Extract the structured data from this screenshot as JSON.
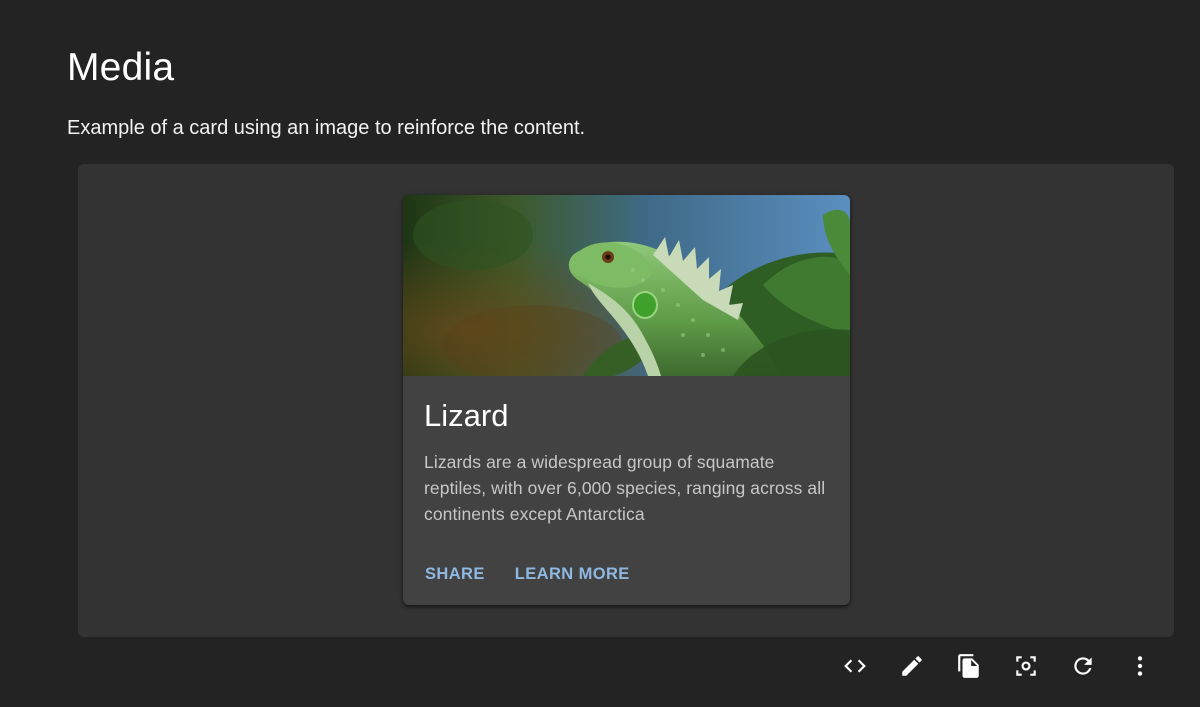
{
  "section": {
    "title": "Media",
    "description": "Example of a card using an image to reinforce the content."
  },
  "card": {
    "heading": "Lizard",
    "body": "Lizards are a widespread group of squamate reptiles, with over 6,000 species, ranging across all continents except Antarctica",
    "media_icon": "green-iguana-image",
    "actions": {
      "share_label": "SHARE",
      "learn_more_label": "LEARN MORE"
    }
  },
  "toolbar": {
    "icons": [
      "code-icon",
      "edit-icon",
      "copy-icon",
      "screenshot-icon",
      "refresh-icon",
      "more-vert-icon"
    ]
  },
  "colors": {
    "page_background": "#232323",
    "stage_background": "#333333",
    "card_background": "#424242",
    "accent": "#8fb8e0"
  }
}
